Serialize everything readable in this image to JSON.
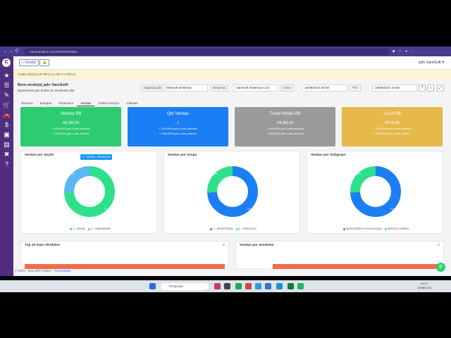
{
  "browser": {
    "url": "meuerponline.com.br/Home/Index",
    "nav_back": "←",
    "nav_forward": "→",
    "nav_reload": "C"
  },
  "sidebar": {
    "logo": "C",
    "icons": [
      "star-icon",
      "list-icon",
      "edit-icon",
      "cart-icon",
      "car-icon",
      "dollar-icon",
      "briefcase-icon",
      "chart-icon",
      "tools-icon",
      "help-icon"
    ],
    "glyphs": [
      "★",
      "☰",
      "✎",
      "🛒",
      "🚗",
      "$",
      "▣",
      "▤",
      "✖",
      "?"
    ]
  },
  "topbar": {
    "ocultar": "« Ocultar",
    "lock": "🔒",
    "user": "pdv VareSoft ▾"
  },
  "banner": "Conta Oficial com NFC-e e NF-e e NFs-e",
  "welcome": {
    "title": "Bem-vindo(a) pdv VareSoft!",
    "subtitle": "Esperamos que tenha um excelente dia!"
  },
  "filters": {
    "organizacao_label": "Organização",
    "organizacao_value": "VareSoft Sistemas",
    "empresa_label": "Empresa",
    "empresa_value": "VareSoft Sistemas Com",
    "inicio_label": "Início",
    "inicio_value": "15/08/2024 00:00",
    "fim_label": "Fim",
    "fim_value": "15/08/2024 23:59"
  },
  "tabs": [
    "Resumo",
    "Estoque",
    "Financeiro",
    "Vendas",
    "Ordem Serviço",
    "Clientes"
  ],
  "kpis": [
    {
      "title": "Vendas R$",
      "value": "R$ 389,99",
      "line1": "+ 100,00% que o mês anterior",
      "line2": "+ 100,00% que o ano anterior",
      "color": "#2ecc71"
    },
    {
      "title": "Qtd Vendas",
      "value": "1",
      "line1": "+ 100,00% que o mês anterior",
      "line2": "+ 100,00% que o ano anterior",
      "color": "#1a7ef5"
    },
    {
      "title": "Ticket Médio R$",
      "value": "R$ 389,99",
      "line1": "+ 100,00% que o mês anterior",
      "line2": "+ 100,00% que o ano anterior",
      "color": "#9a9a9a"
    },
    {
      "title": "Lucro R$",
      "value": "R$ 90,00",
      "line1": "+ 100,00% que o mês anterior",
      "line2": "+ 100,00% que o ano anterior",
      "color": "#e5b94a"
    }
  ],
  "charts": [
    {
      "title": "Vendas por Seção",
      "tooltip": "1 - GERAL : R$ 289,99",
      "labels": [
        "74,4%",
        "25,6%"
      ],
      "legend": [
        "1 - GERAL",
        "2 - HARDWARE"
      ],
      "colors": [
        "#2ee08a",
        "#5bb8f5"
      ]
    },
    {
      "title": "Vendas por Grupo",
      "labels": [
        "74,4%",
        "25,6%"
      ],
      "legend": [
        "2 - MONITORES",
        "3 - SERVIÇOS"
      ],
      "colors": [
        "#1a7ef5",
        "#2ee08a"
      ]
    },
    {
      "title": "Vendas por Subgrupo",
      "labels": [
        "74,4%",
        "25,6%"
      ],
      "legend": [
        "MONITORES 9 POLEGADAS",
        "SERVIÇO GERAL"
      ],
      "colors": [
        "#1a7ef5",
        "#2ee08a"
      ]
    }
  ],
  "chart_data": [
    {
      "type": "pie",
      "title": "Vendas por Seção",
      "categories": [
        "1 - GERAL",
        "2 - HARDWARE"
      ],
      "values": [
        74.4,
        25.6
      ]
    },
    {
      "type": "pie",
      "title": "Vendas por Grupo",
      "categories": [
        "2 - MONITORES",
        "3 - SERVIÇOS"
      ],
      "values": [
        74.4,
        25.6
      ]
    },
    {
      "type": "pie",
      "title": "Vendas por Subgrupo",
      "categories": [
        "MONITORES 9 POLEGADAS",
        "SERVIÇO GERAL"
      ],
      "values": [
        74.4,
        25.6
      ]
    }
  ],
  "bottom_cards": {
    "left": "Top 10 mais Vendidos",
    "right": "Vendas por Vendedor"
  },
  "footer": {
    "text": "© 2024 - Meu ERP Online - ",
    "link": "Privacidade"
  },
  "taskbar": {
    "search": "Pesquisar",
    "time": "19:27",
    "date": "15/08/2024"
  }
}
